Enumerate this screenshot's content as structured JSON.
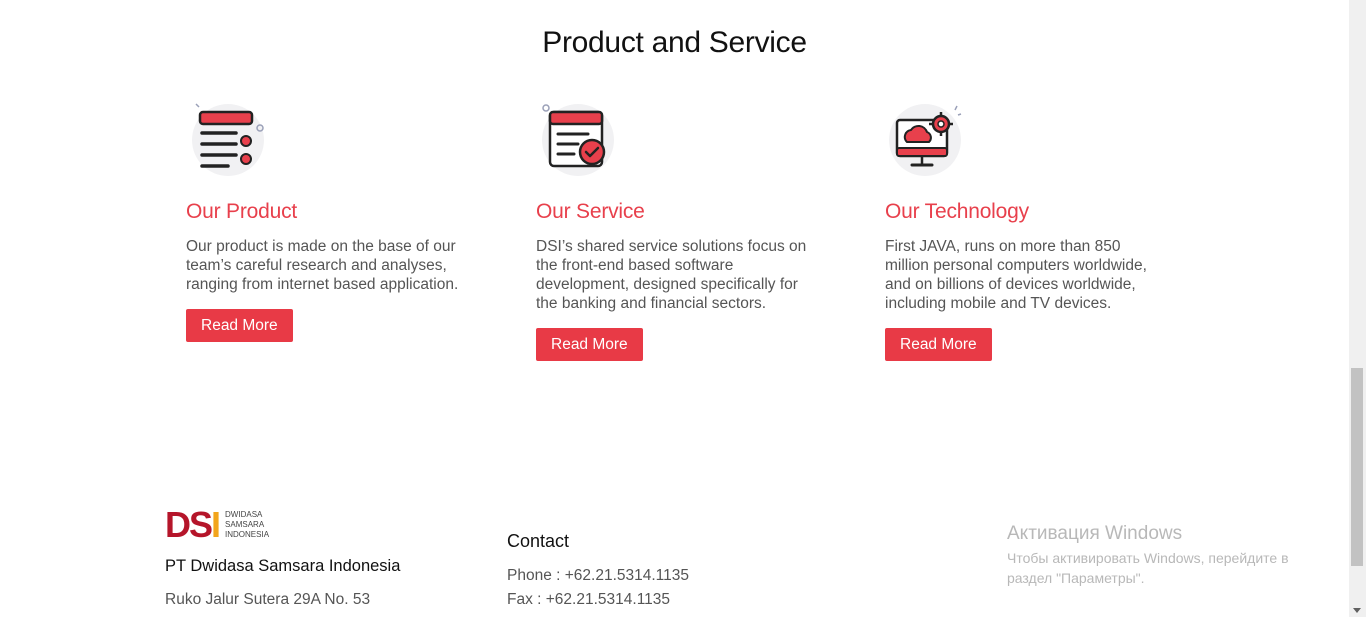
{
  "section": {
    "title": "Product and Service"
  },
  "cards": [
    {
      "icon": "list-document-icon",
      "title": "Our Product",
      "text": "Our product is made on the base of our team’s careful research and analyses, ranging from internet based application.",
      "button": "Read More"
    },
    {
      "icon": "document-check-icon",
      "title": "Our Service",
      "text": "DSI’s shared service solutions focus on the front-end based software development, designed specifically for the banking and financial sectors.",
      "button": "Read More"
    },
    {
      "icon": "monitor-cloud-gear-icon",
      "title": "Our Technology",
      "text": "First JAVA, runs on more than 850 million personal computers worldwide, and on billions of devices worldwide, including mobile and TV devices.",
      "button": "Read More"
    }
  ],
  "footer": {
    "logo_mark": "DSI",
    "logo_lines": [
      "DWIDASA",
      "SAMSARA",
      "INDONESIA"
    ],
    "company_name": "PT Dwidasa Samsara Indonesia",
    "address": "Ruko Jalur Sutera 29A No. 53",
    "contact_title": "Contact",
    "phone": "Phone : +62.21.5314.1135",
    "fax": "Fax : +62.21.5314.1135"
  },
  "windows_activation": {
    "title": "Активация Windows",
    "line1": "Чтобы активировать Windows, перейдите в",
    "line2": "раздел \"Параметры\"."
  },
  "colors": {
    "accent": "#e8404c",
    "button": "#e83a46",
    "logo_red": "#b5152a",
    "logo_yellow": "#f2a51c"
  }
}
